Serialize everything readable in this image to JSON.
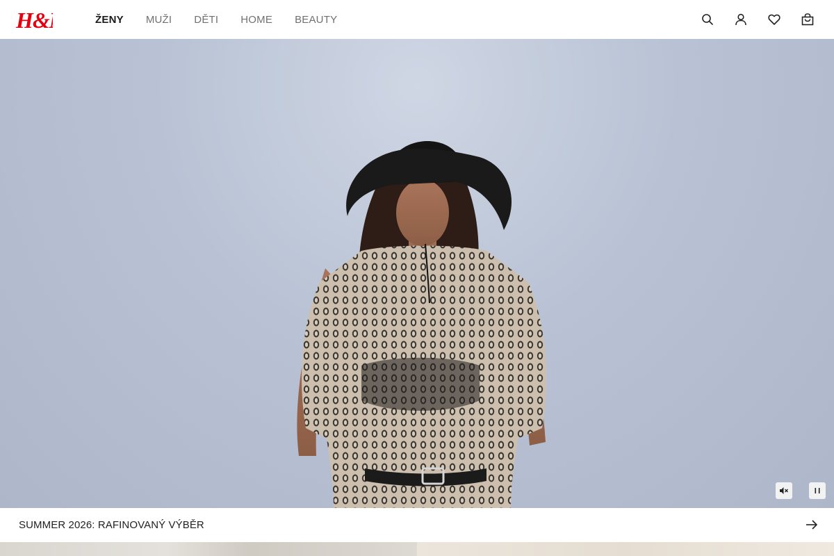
{
  "brand": {
    "name": "H&M",
    "color": "#e50010"
  },
  "nav": {
    "items": [
      {
        "label": "ŽENY",
        "active": true
      },
      {
        "label": "MUŽI",
        "active": false
      },
      {
        "label": "DĚTI",
        "active": false
      },
      {
        "label": "HOME",
        "active": false
      },
      {
        "label": "BEAUTY",
        "active": false
      }
    ]
  },
  "header_actions": {
    "icons": [
      "search-icon",
      "account-icon",
      "favorites-heart-icon",
      "shopping-bag-icon"
    ]
  },
  "hero": {
    "media_controls": {
      "mute_icon": "speaker-muted-icon",
      "pause_icon": "pause-icon"
    }
  },
  "caption": {
    "text": "SUMMER 2026: RAFINOVANÝ VÝBĚR",
    "arrow_icon": "arrow-right-icon"
  },
  "colors": {
    "text_active": "#1a1a1a",
    "text_muted": "#707070",
    "hero_background": "#b8c2d4"
  }
}
